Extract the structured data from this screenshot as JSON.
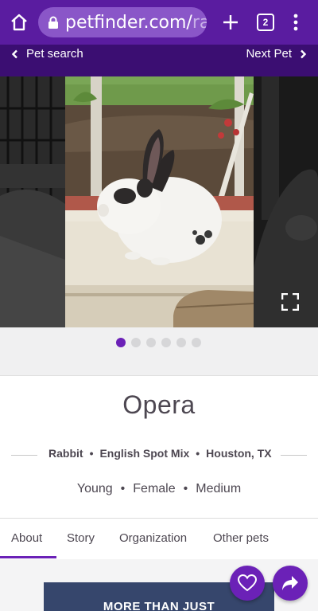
{
  "browser": {
    "url_main": "petfinder.com/",
    "url_faded": "ra",
    "tab_count": "2"
  },
  "pet_nav": {
    "back_label": "Pet search",
    "next_label": "Next Pet"
  },
  "gallery": {
    "photo_count": 6,
    "active_index": 0
  },
  "pet": {
    "name": "Opera",
    "species": "Rabbit",
    "breed": "English Spot Mix",
    "location": "Houston, TX",
    "age": "Young",
    "sex": "Female",
    "size": "Medium"
  },
  "tabs": [
    {
      "label": "About"
    },
    {
      "label": "Story"
    },
    {
      "label": "Organization"
    },
    {
      "label": "Other pets"
    }
  ],
  "banner": {
    "text": "MORE THAN JUST"
  },
  "colors": {
    "browser_bar": "#5a1ca0",
    "pet_nav": "#3b0e72",
    "accent": "#6b21b7",
    "banner": "#36466c"
  }
}
